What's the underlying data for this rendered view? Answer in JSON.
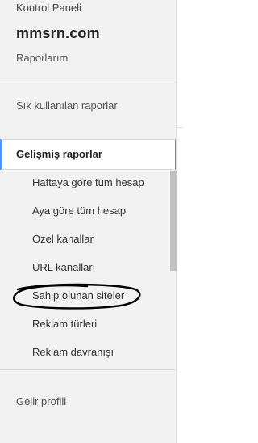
{
  "header": {
    "breadcrumb": "Kontrol Paneli",
    "site_name": "mmsrn.com",
    "my_reports": "Raporlarım",
    "frequent_reports": "Sık kullanılan raporlar"
  },
  "advanced": {
    "title": "Gelişmiş raporlar",
    "items": [
      {
        "label": "Haftaya göre tüm hesap"
      },
      {
        "label": "Aya göre tüm hesap"
      },
      {
        "label": "Özel kanallar"
      },
      {
        "label": "URL kanalları"
      },
      {
        "label": "Sahip olunan siteler"
      },
      {
        "label": "Reklam türleri"
      },
      {
        "label": "Reklam davranışı"
      }
    ]
  },
  "footer": {
    "revenue_profile": "Gelir profili"
  },
  "colors": {
    "accent": "#4d90fe",
    "sidebar_bg": "#f1f1f1",
    "annotation": "#000000"
  }
}
